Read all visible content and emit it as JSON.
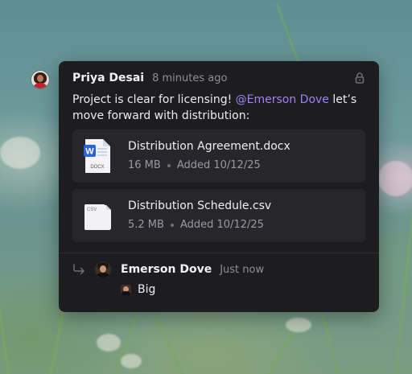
{
  "comment": {
    "author": "Priya Desai",
    "timestamp": "8 minutes ago",
    "message_before": "Project is clear for licensing! ",
    "mention": "@Emerson Dove",
    "message_after": " let’s move forward with distribution:"
  },
  "attachments": [
    {
      "name": "Distribution Agreement.docx",
      "size": "16 MB",
      "added": "Added 10/12/25",
      "icon": "word-document-icon",
      "icon_label": "DOCX",
      "icon_letter": "W"
    },
    {
      "name": "Distribution Schedule.csv",
      "size": "5.2 MB",
      "added": "Added 10/12/25",
      "icon": "csv-file-icon",
      "icon_label": "CSV"
    }
  ],
  "reply": {
    "author": "Emerson Dove",
    "timestamp": "Just now",
    "text": "Big"
  },
  "colors": {
    "card_background": "#1d1d20",
    "attachment_background": "#27272b",
    "mention": "#9d84f5",
    "word_blue": "#2b63d9"
  }
}
